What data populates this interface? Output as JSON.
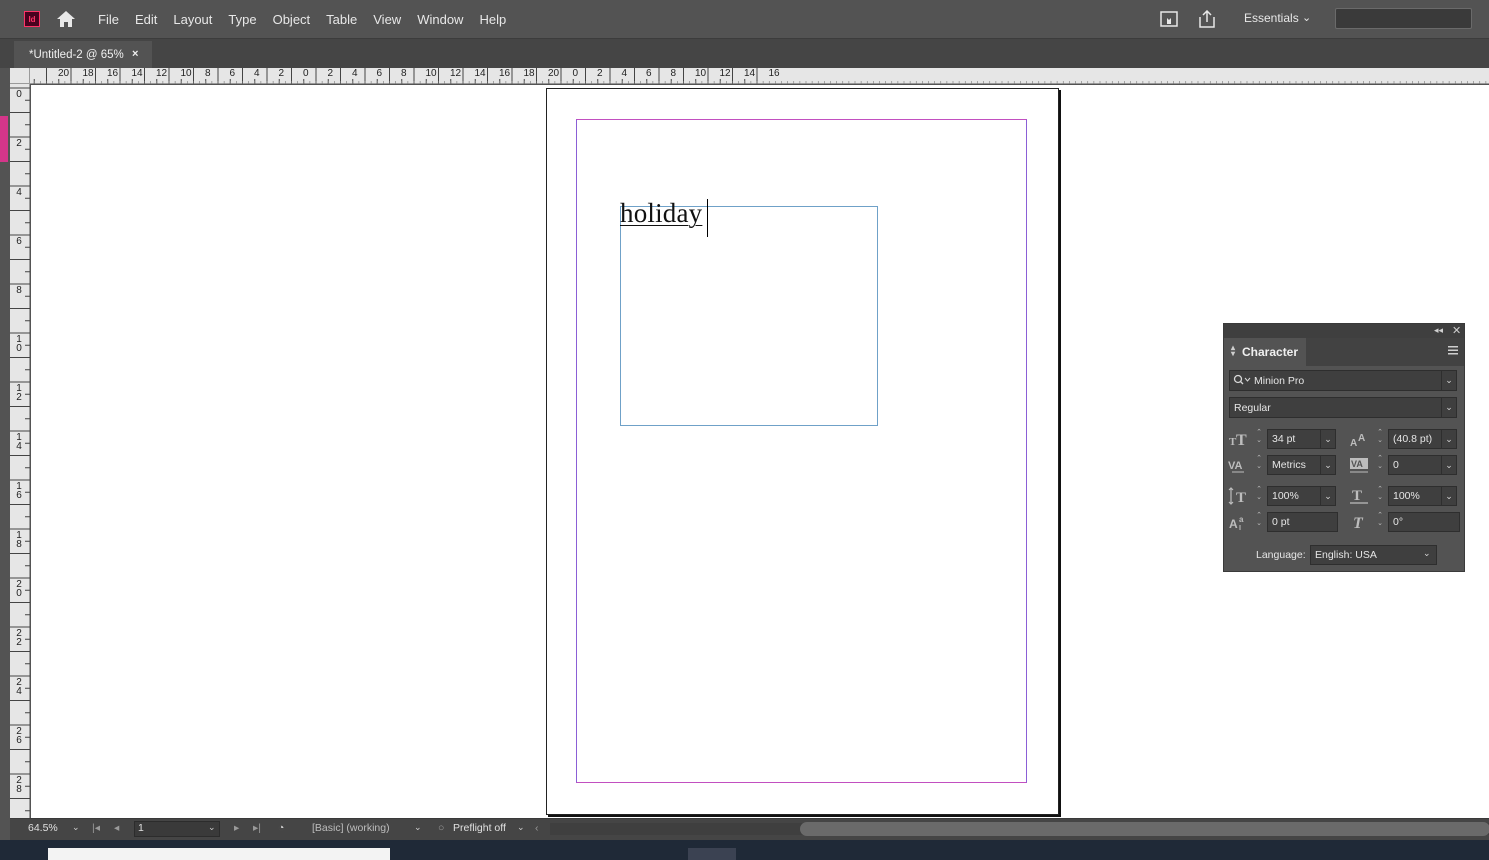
{
  "menubar": {
    "app_logo": "Id",
    "items": [
      "File",
      "Edit",
      "Layout",
      "Type",
      "Object",
      "Table",
      "View",
      "Window",
      "Help"
    ],
    "workspace": "Essentials",
    "icons": [
      "home-icon",
      "publish-online-icon",
      "share-icon",
      "chevron-down-icon"
    ]
  },
  "document_tab": {
    "title": "*Untitled-2 @ 65%",
    "close": "×"
  },
  "rulers": {
    "horizontal": [
      "20",
      "18",
      "16",
      "14",
      "12",
      "10",
      "8",
      "6",
      "4",
      "2",
      "0",
      "2",
      "4",
      "6",
      "8",
      "10",
      "12",
      "14",
      "16",
      "18",
      "20",
      "0",
      "2",
      "4",
      "6",
      "8",
      "10",
      "12",
      "14",
      "16"
    ],
    "vertical": [
      "0",
      "2",
      "4",
      "6",
      "8",
      "1 0",
      "1 2",
      "1 4",
      "1 6",
      "1 8",
      "2 0",
      "2 2",
      "2 4",
      "2 6",
      "2 8"
    ]
  },
  "canvas": {
    "frame_text": "holiday"
  },
  "character_panel": {
    "title": "Character",
    "font_family": "Minion Pro",
    "font_style": "Regular",
    "font_size": "34 pt",
    "leading": "(40.8 pt)",
    "kerning": "Metrics",
    "tracking": "0",
    "vertical_scale": "100%",
    "horizontal_scale": "100%",
    "baseline_shift": "0 pt",
    "skew": "0°",
    "language_label": "Language:",
    "language": "English: USA"
  },
  "statusbar": {
    "zoom": "64.5%",
    "page": "1",
    "style": "[Basic] (working)",
    "preflight": "Preflight off"
  },
  "colors": {
    "chrome": "#535353",
    "tab_bar": "#454545",
    "margin_guide": "#c24fc0",
    "text_frame": "#6fa1c8",
    "app_accent": "#ff3366"
  }
}
